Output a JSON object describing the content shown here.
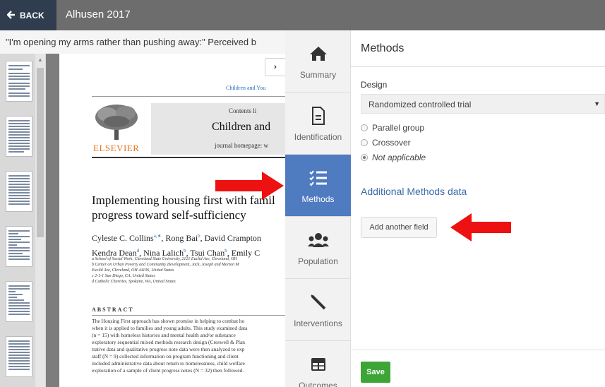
{
  "topbar": {
    "back_label": "BACK",
    "doc_title": "Alhusen 2017"
  },
  "viewer": {
    "title": "\"I'm opening my arms rather than pushing away:\" Perceived b",
    "page": {
      "journal_top": "Children and You",
      "contents": "Contents li",
      "journal_name": "Children and",
      "publisher": "ELSEVIER",
      "homepage": "journal homepage: w",
      "article_title": "Implementing housing first with famil progress toward self-sufficiency",
      "authors_line1": "Cyleste C. Collins",
      "authors_line1_rest": ", Rong Bai",
      "authors_line1_rest2": ", David Crampton",
      "authors_line2": "Kendra Dean",
      "authors_line2_rest": ", Nina Lalich",
      "authors_line2_rest2": ", Tsui Chan",
      "authors_line2_rest3": ", Emily C",
      "aff_lines": [
        "a School of Social Work, Cleveland State University, 2121 Euclid Ave, Cleveland, OH",
        "b Center on Urban Poverty and Community Development, Jack, Joseph and Morton M",
        "Euclid Ave, Cleveland, OH 44106, United States",
        "c 2-1-1 San Diego, CA, United States",
        "d Catholic Charities, Spokane, WA, United States"
      ],
      "abstract_heading": "ABSTRACT",
      "abstract_lines": [
        "The Housing First approach has shown promise in helping to combat ho",
        "when it is applied to families and young adults. This study examined data",
        "(n = 15) with homeless histories and mental health and/or substance",
        "exploratory sequential mixed methods research design (Creswell & Plan",
        "trative data and qualitative progress note data were then analyzed to exp",
        "staff (N = 9) collected information on program functioning and client",
        "included administrative data about return to homelessness, child welfare",
        "exploration of a sample of client progress notes (N = 32) then followed."
      ]
    }
  },
  "vnav": {
    "items": [
      {
        "label": "Summary",
        "icon": "home-icon"
      },
      {
        "label": "Identification",
        "icon": "document-icon"
      },
      {
        "label": "Methods",
        "icon": "checklist-icon",
        "active": true
      },
      {
        "label": "Population",
        "icon": "users-icon"
      },
      {
        "label": "Interventions",
        "icon": "syringe-icon"
      },
      {
        "label": "Outcomes",
        "icon": "table-icon"
      }
    ]
  },
  "panel": {
    "title": "Methods",
    "design_label": "Design",
    "design_value": "Randomized controlled trial",
    "radios": [
      {
        "label": "Parallel group",
        "checked": false
      },
      {
        "label": "Crossover",
        "checked": false
      },
      {
        "label": "Not applicable",
        "checked": true
      }
    ],
    "additional_label": "Additional Methods data",
    "add_field_label": "Add another field",
    "save_label": "Save"
  },
  "colors": {
    "accent": "#4f7bc0",
    "save": "#3ca535",
    "arrow": "#ee1111",
    "back": "#2f3d4f",
    "topbar": "#6d6d6d"
  }
}
